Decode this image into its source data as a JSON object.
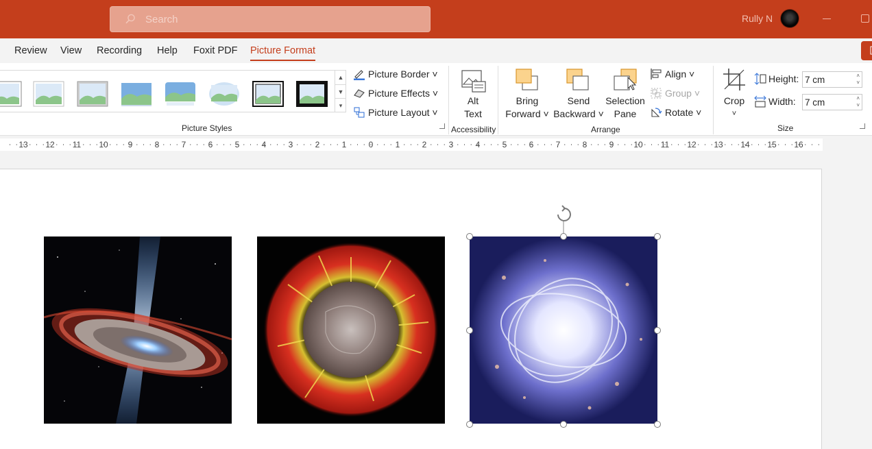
{
  "titlebar": {
    "search_placeholder": "Search",
    "user_name": "Rully N",
    "accent_color": "#c43e1c"
  },
  "tabs": [
    {
      "label": "Review"
    },
    {
      "label": "View"
    },
    {
      "label": "Recording"
    },
    {
      "label": "Help"
    },
    {
      "label": "Foxit PDF"
    },
    {
      "label": "Picture Format",
      "active": true
    }
  ],
  "ribbon": {
    "picture_styles": {
      "label": "Picture Styles",
      "style_count_visible": 8,
      "picture_border": "Picture Border",
      "picture_effects": "Picture Effects",
      "picture_layout": "Picture Layout"
    },
    "accessibility": {
      "label": "Accessibility",
      "alt_text_line1": "Alt",
      "alt_text_line2": "Text"
    },
    "arrange": {
      "label": "Arrange",
      "bring_forward_line1": "Bring",
      "bring_forward_line2": "Forward",
      "send_backward_line1": "Send",
      "send_backward_line2": "Backward",
      "selection_pane_line1": "Selection",
      "selection_pane_line2": "Pane",
      "align": "Align",
      "group": "Group",
      "rotate": "Rotate"
    },
    "size": {
      "label": "Size",
      "crop": "Crop",
      "height_label": "Height:",
      "height_value": "7 cm",
      "width_label": "Width:",
      "width_value": "7 cm"
    }
  },
  "ruler": {
    "labels": [
      "13",
      "12",
      "11",
      "10",
      "9",
      "8",
      "7",
      "6",
      "5",
      "4",
      "3",
      "2",
      "1",
      "0",
      "1",
      "2",
      "3",
      "4",
      "5",
      "6",
      "7",
      "8",
      "9",
      "10",
      "11",
      "12",
      "13",
      "14",
      "15",
      "16"
    ]
  },
  "slide": {
    "pictures": [
      {
        "name": "black-hole-jet-picture",
        "selected": false
      },
      {
        "name": "supernova-burst-picture",
        "selected": false
      },
      {
        "name": "glowing-galaxy-picture",
        "selected": true
      }
    ]
  }
}
